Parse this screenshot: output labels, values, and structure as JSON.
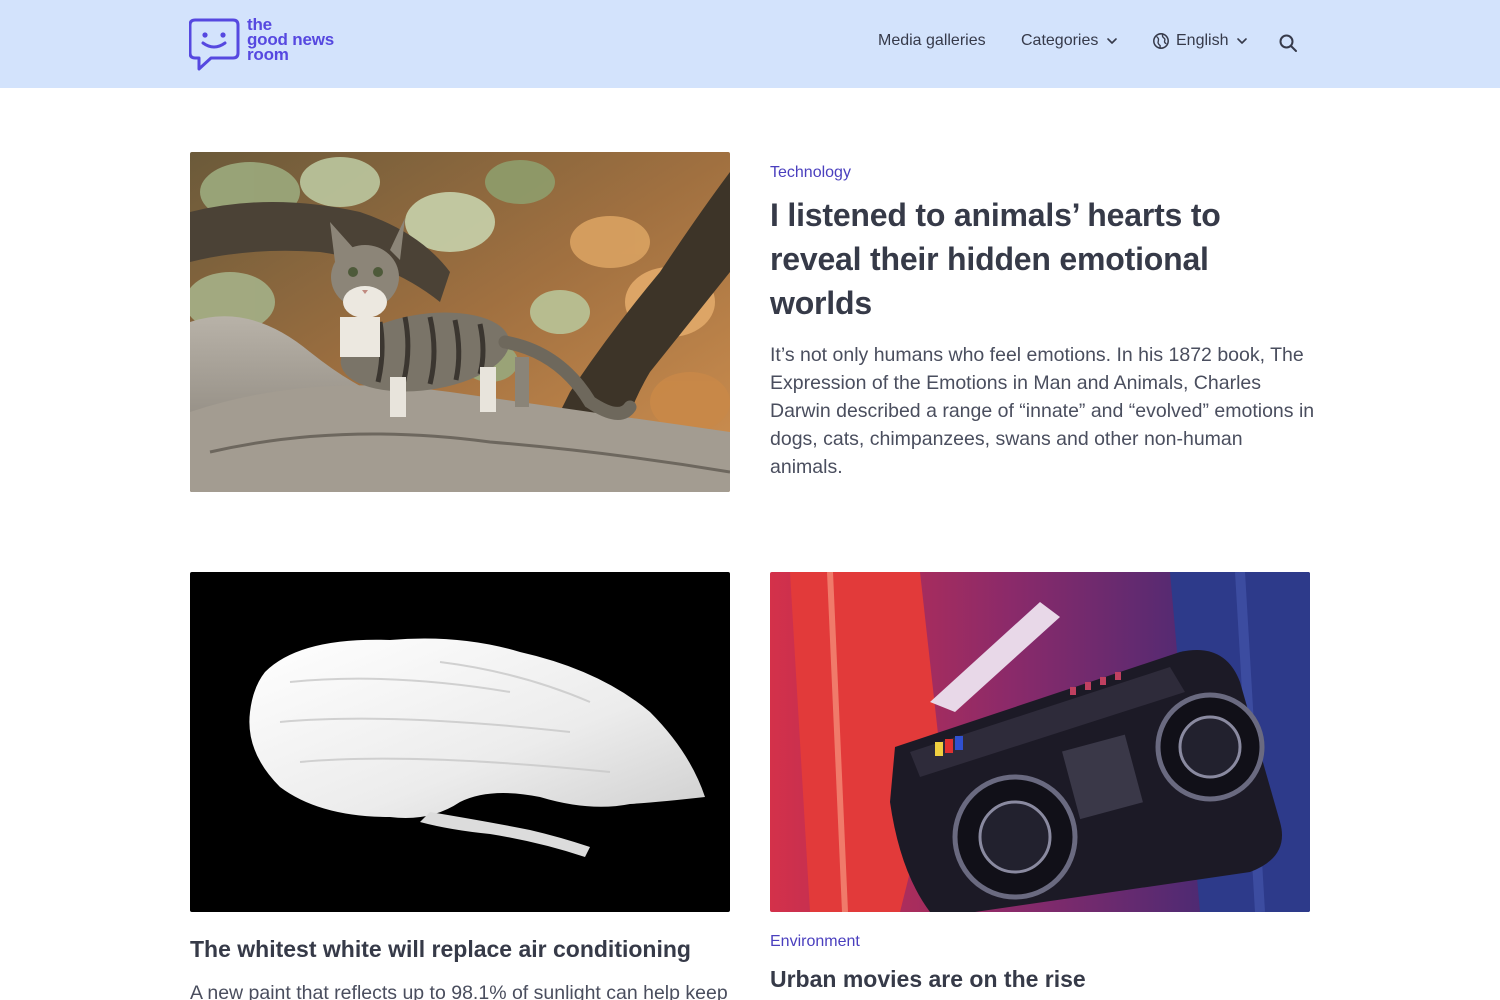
{
  "header": {
    "logo": {
      "line1": "the",
      "line2": "good news",
      "line3": "room"
    },
    "nav": {
      "media_galleries": "Media galleries",
      "categories": "Categories",
      "language": "English"
    },
    "icons": [
      "logo-chat-icon",
      "chevron-down-icon",
      "globe-icon",
      "search-icon"
    ]
  },
  "featured": {
    "category": "Technology",
    "title": "I listened to animals’ hearts to reveal their hidden emotional worlds",
    "excerpt": "It’s not only humans who feel emotions. In his 1872 book, The Expression of the Emotions in Man and Animals, Charles Darwin described a range of “innate” and “evolved” emotions in dogs, cats, chimpanzees, swans and other non-human animals."
  },
  "articles": [
    {
      "category": "",
      "title": "The whitest white will replace air conditioning",
      "excerpt": "A new paint that reflects up to 98.1% of sunlight can help keep"
    },
    {
      "category": "Environment",
      "title": "Urban movies are on the rise"
    }
  ],
  "colors": {
    "header_bg": "#d3e3fc",
    "brand": "#5648e0",
    "category": "#4a3fbe",
    "text": "#363a48"
  }
}
